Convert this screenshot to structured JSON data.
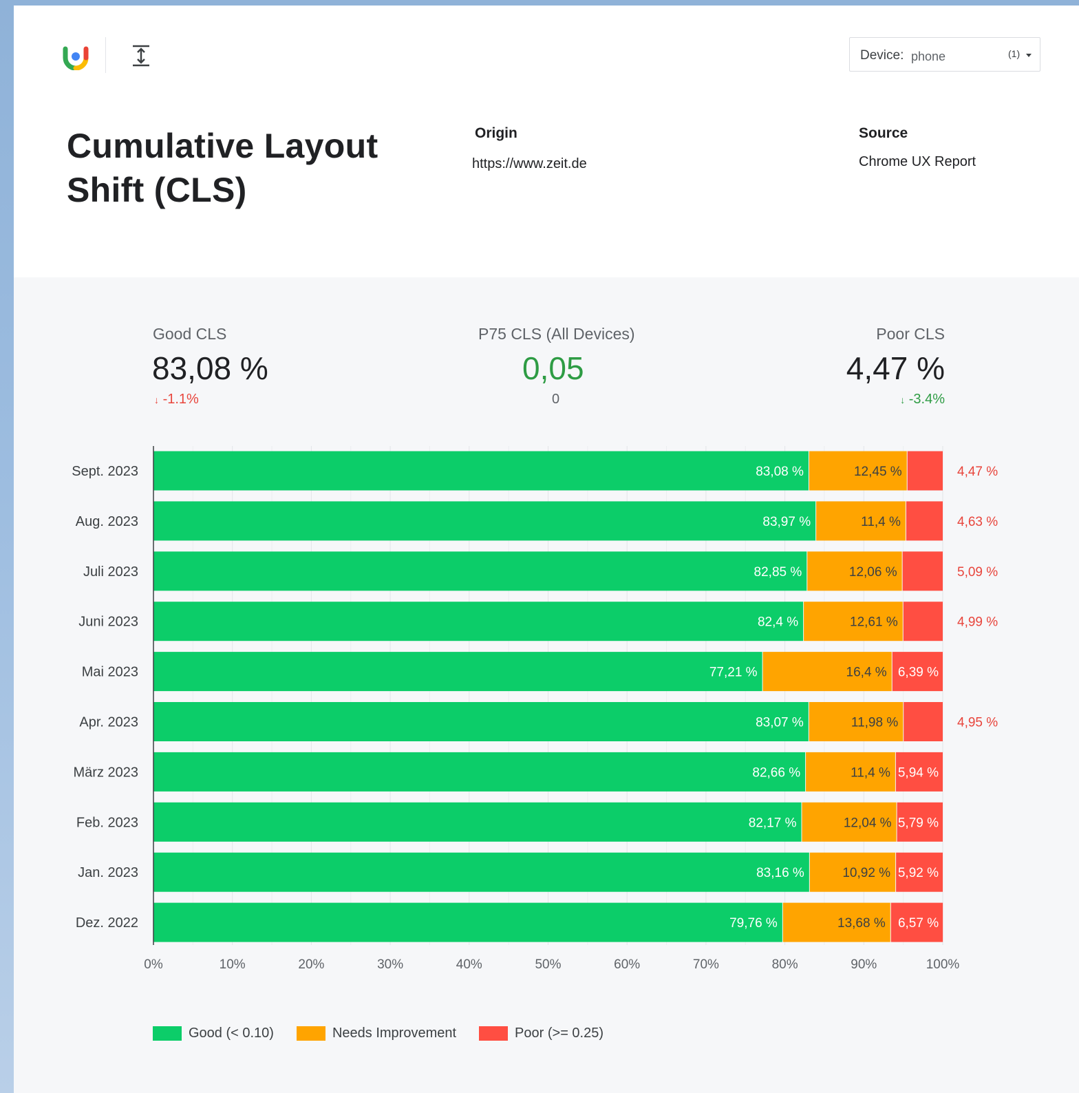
{
  "toolbar": {
    "device_label": "Device:",
    "device_value": "phone",
    "device_count": "(1)"
  },
  "header": {
    "title": "Cumulative Layout Shift (CLS)",
    "origin_label": "Origin",
    "origin_value": "https://www.zeit.de",
    "source_label": "Source",
    "source_value": "Chrome UX Report"
  },
  "kpis": {
    "good": {
      "label": "Good CLS",
      "value": "83,08 %",
      "delta": "-1.1%"
    },
    "p75": {
      "label": "P75 CLS (All Devices)",
      "value": "0,05",
      "sub": "0"
    },
    "poor": {
      "label": "Poor CLS",
      "value": "4,47 %",
      "delta": "-3.4%"
    }
  },
  "colors": {
    "good": "#0ccd69",
    "needs_improvement": "#ffa400",
    "poor": "#ff4e42",
    "positive_text": "#2e9c44",
    "negative_text": "#e8453c"
  },
  "chart_data": {
    "type": "bar",
    "orientation": "horizontal",
    "stacked": true,
    "categories": [
      "Sept. 2023",
      "Aug. 2023",
      "Juli 2023",
      "Juni 2023",
      "Mai 2023",
      "Apr. 2023",
      "März 2023",
      "Feb. 2023",
      "Jan. 2023",
      "Dez. 2022"
    ],
    "series": [
      {
        "name": "Good (< 0.10)",
        "values": [
          83.08,
          83.97,
          82.85,
          82.4,
          77.21,
          83.07,
          82.66,
          82.17,
          83.16,
          79.76
        ],
        "labels": [
          "83,08 %",
          "83,97 %",
          "82,85 %",
          "82,4 %",
          "77,21 %",
          "83,07 %",
          "82,66 %",
          "82,17 %",
          "83,16 %",
          "79,76 %"
        ]
      },
      {
        "name": "Needs Improvement",
        "values": [
          12.45,
          11.4,
          12.06,
          12.61,
          16.4,
          11.98,
          11.4,
          12.04,
          10.92,
          13.68
        ],
        "labels": [
          "12,45 %",
          "11,4 %",
          "12,06 %",
          "12,61 %",
          "16,4 %",
          "11,98 %",
          "11,4 %",
          "12,04 %",
          "10,92 %",
          "13,68 %"
        ]
      },
      {
        "name": "Poor (>= 0.25)",
        "values": [
          4.47,
          4.63,
          5.09,
          4.99,
          6.39,
          4.95,
          5.94,
          5.79,
          5.92,
          6.57
        ],
        "labels": [
          "4,47 %",
          "4,63 %",
          "5,09 %",
          "4,99 %",
          "6,39 %",
          "4,95 %",
          "5,94 %",
          "5,79 %",
          "5,92 %",
          "6,57 %"
        ]
      }
    ],
    "x_ticks": [
      "0%",
      "10%",
      "20%",
      "30%",
      "40%",
      "50%",
      "60%",
      "70%",
      "80%",
      "90%",
      "100%"
    ],
    "xlim": [
      0,
      100
    ],
    "grid": true,
    "legend_position": "bottom-left"
  }
}
